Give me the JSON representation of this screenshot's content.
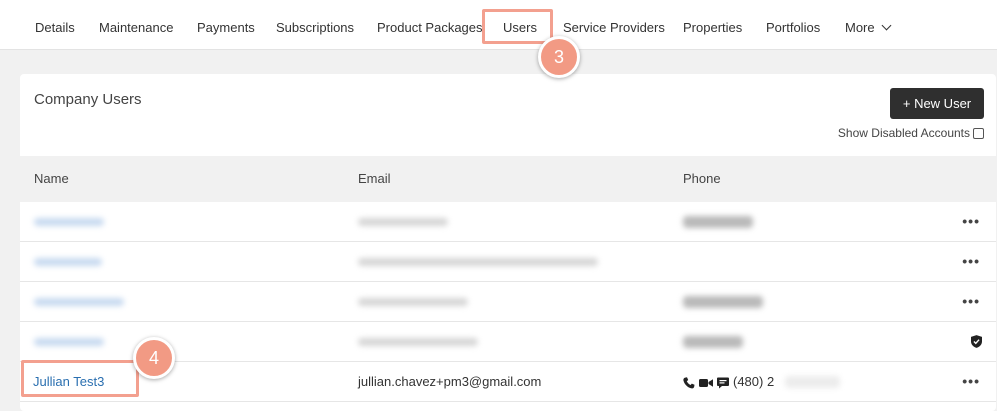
{
  "tabs": [
    {
      "label": "Details"
    },
    {
      "label": "Maintenance"
    },
    {
      "label": "Payments"
    },
    {
      "label": "Subscriptions"
    },
    {
      "label": "Product Packages"
    },
    {
      "label": "Users"
    },
    {
      "label": "Service Providers"
    },
    {
      "label": "Properties"
    },
    {
      "label": "Portfolios"
    },
    {
      "label": "More"
    }
  ],
  "active_tab": "Users",
  "steps": {
    "users_tab_step": "3",
    "user_link_step": "4"
  },
  "card": {
    "title": "Company Users",
    "new_user_label": "+ New User",
    "show_disabled_label": "Show Disabled Accounts"
  },
  "table": {
    "columns": [
      "Name",
      "Email",
      "Phone"
    ],
    "visible_row": {
      "name": "Jullian Test3",
      "email": "jullian.chavez+pm3@gmail.com",
      "phone": "(480) 2"
    },
    "more_label": "•••"
  },
  "colors": {
    "accent_highlight": "#f3a08f",
    "badge": "#f29a84",
    "link": "#2a6fb0",
    "button": "#2f2f2f"
  },
  "icons": [
    "chevron-down-icon",
    "phone-icon",
    "video-icon",
    "chat-icon",
    "shield-icon",
    "more-icon",
    "checkbox-icon"
  ]
}
